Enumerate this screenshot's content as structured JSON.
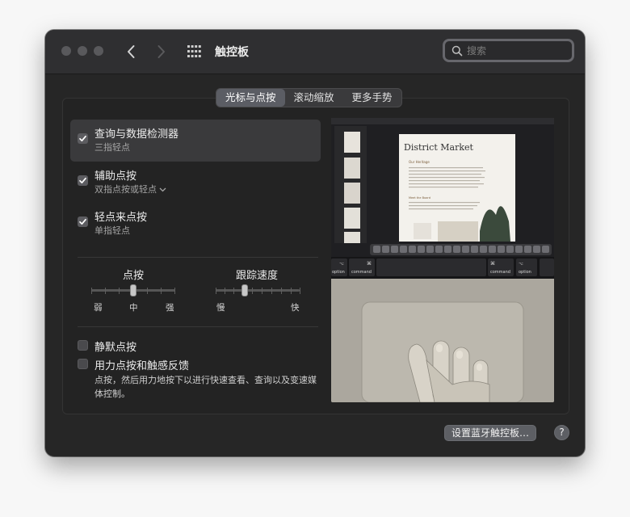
{
  "window": {
    "title": "触控板",
    "search": {
      "placeholder": "搜索",
      "value": ""
    }
  },
  "tabs": [
    {
      "label": "光标与点按",
      "active": true
    },
    {
      "label": "滚动缩放",
      "active": false
    },
    {
      "label": "更多手势",
      "active": false
    }
  ],
  "options": [
    {
      "title": "查询与数据检测器",
      "subtitle": "三指轻点",
      "checked": true,
      "selected": true
    },
    {
      "title": "辅助点按",
      "subtitle": "双指点按或轻点",
      "checked": true,
      "has_menu": true
    },
    {
      "title": "轻点来点按",
      "subtitle": "单指轻点",
      "checked": true
    }
  ],
  "sliders": {
    "click": {
      "title": "点按",
      "labels": [
        "弱",
        "中",
        "强"
      ],
      "level": 0.5
    },
    "tracking": {
      "title": "跟踪速度",
      "labels": [
        "慢",
        "快"
      ],
      "level": 0.35
    }
  },
  "options2": [
    {
      "title": "静默点按",
      "checked": false
    },
    {
      "title": "用力点按和触感反馈",
      "checked": false
    }
  ],
  "force_click_desc": "点按，然后用力地按下以进行快速查看、查询以及变速媒体控制。",
  "preview": {
    "doc_title": "District Market",
    "doc_subtitle": "Our Heritage",
    "doc_section": "Meet the Board",
    "keys": [
      {
        "symbol": "⌥",
        "label": "option"
      },
      {
        "symbol": "⌘",
        "label": "command"
      },
      {
        "symbol": "⌘",
        "label": "command"
      },
      {
        "symbol": "⌥",
        "label": "option"
      }
    ]
  },
  "bottom": {
    "setup_button": "设置蓝牙触控板…",
    "help": "?"
  },
  "colors": {
    "window_bg": "#262626",
    "titlebar_bg": "#2f2f31",
    "selected_tab": "#5b5d64",
    "checkbox_checked": "#5c5c60"
  }
}
